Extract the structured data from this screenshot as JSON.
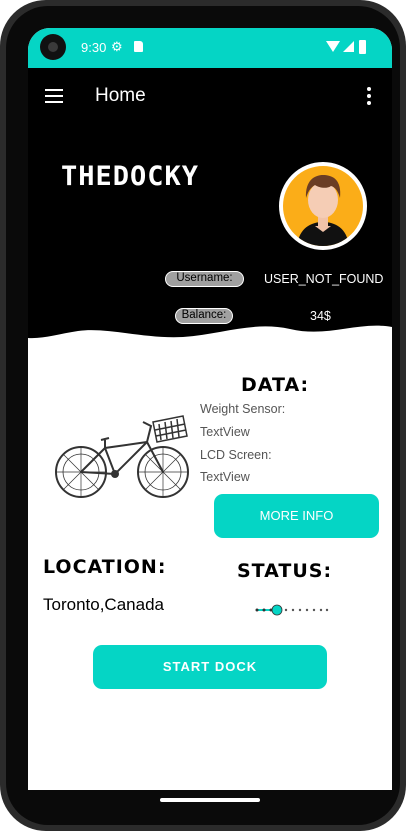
{
  "status_bar": {
    "time": "9:30",
    "settings_icon": "gear-icon",
    "sd_icon": "sd-card-icon",
    "wifi_icon": "wifi-icon",
    "signal_icon": "signal-icon",
    "battery_icon": "battery-icon"
  },
  "appbar": {
    "title": "Home",
    "menu_icon": "hamburger-menu-icon",
    "overflow_icon": "more-vert-icon"
  },
  "profile": {
    "brand": "THEDOCKY",
    "username_label": "Username:",
    "username_value": "USER_NOT_FOUND",
    "balance_label": "Balance:",
    "balance_value": "34$"
  },
  "data_section": {
    "title": "DATA:",
    "weight_label": "Weight Sensor:",
    "weight_value": "TextView",
    "lcd_label": "LCD Screen:",
    "lcd_value": "TextView",
    "more_info_button": "MORE INFO"
  },
  "location": {
    "title": "LOCATION:",
    "value": "Toronto,Canada"
  },
  "status": {
    "title": "STATUS:",
    "progress_fraction": 0.2
  },
  "start_button": "START DOCK",
  "colors": {
    "accent": "#05d5c5",
    "header_bg": "#000000",
    "avatar_bg": "#fbad18"
  }
}
